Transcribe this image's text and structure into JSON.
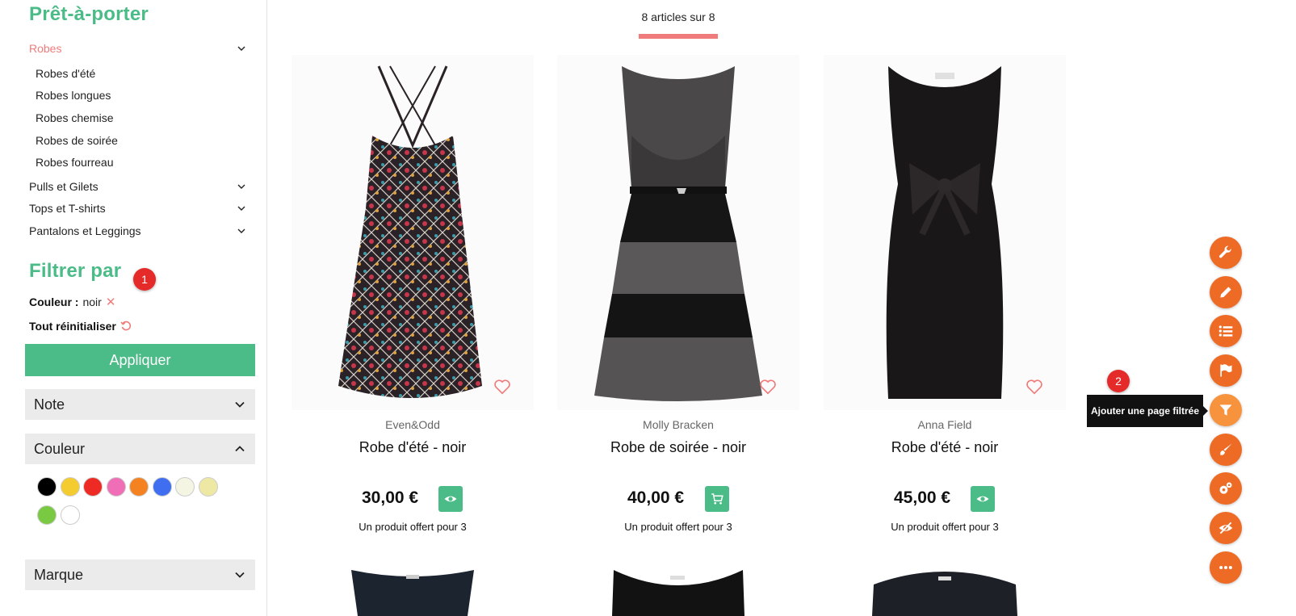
{
  "sidebar": {
    "section_title": "Prêt-à-porter",
    "categories": [
      {
        "label": "Robes",
        "active": true
      },
      {
        "label": "Pulls et Gilets"
      },
      {
        "label": "Tops et T-shirts"
      },
      {
        "label": "Pantalons et Leggings"
      }
    ],
    "subcategories": [
      "Robes d'été",
      "Robes longues",
      "Robes chemise",
      "Robes de soirée",
      "Robes fourreau"
    ],
    "filter_title": "Filtrer par",
    "active_filter": {
      "label": "Couleur :",
      "value": "noir"
    },
    "reset_label": "Tout réinitialiser",
    "apply_label": "Appliquer",
    "accordions": {
      "note": "Note",
      "couleur": "Couleur",
      "marque": "Marque"
    },
    "colors": [
      "#000000",
      "#f5cc2f",
      "#ee2a24",
      "#f06eb5",
      "#f58220",
      "#3f6ff0",
      "#f4f5e2",
      "#ede9a4",
      "#7ac943",
      "#ffffff"
    ]
  },
  "badges": {
    "one": "1",
    "two": "2"
  },
  "main": {
    "count": "8 articles sur 8",
    "products": [
      {
        "brand": "Even&Odd",
        "name": "Robe d'été - noir",
        "price": "30,00 €",
        "action": "eye-icon",
        "promo": "Un produit offert pour 3"
      },
      {
        "brand": "Molly Bracken",
        "name": "Robe de soirée - noir",
        "price": "40,00 €",
        "action": "cart-icon",
        "promo": "Un produit offert pour 3"
      },
      {
        "brand": "Anna Field",
        "name": "Robe d'été - noir",
        "price": "45,00 €",
        "action": "eye-icon",
        "promo": "Un produit offert pour 3"
      }
    ]
  },
  "toolbar": {
    "tooltip": "Ajouter une page filtrée",
    "buttons": [
      "wrench-icon",
      "pencil-icon",
      "list-icon",
      "flag-icon",
      "filter-icon",
      "brush-icon",
      "gears-icon",
      "eye-off-icon",
      "more-icon"
    ]
  },
  "accent": {
    "green": "#4bbb87",
    "coral": "#f07b7b",
    "orange": "#ee6b25"
  }
}
